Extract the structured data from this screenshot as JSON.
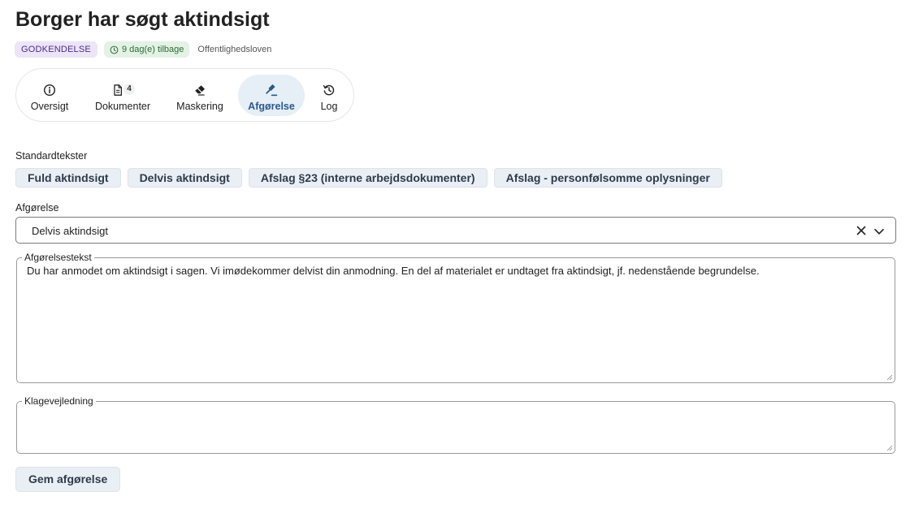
{
  "header": {
    "title": "Borger har søgt aktindsigt",
    "status_chip": "GODKENDELSE",
    "deadline_chip": "9 dag(e) tilbage",
    "law_chip": "Offentlighedsloven"
  },
  "tabs": [
    {
      "label": "Oversigt",
      "icon": "info-icon"
    },
    {
      "label": "Dokumenter",
      "icon": "document-icon",
      "badge": "4"
    },
    {
      "label": "Maskering",
      "icon": "eraser-icon"
    },
    {
      "label": "Afgørelse",
      "icon": "gavel-icon",
      "active": true
    },
    {
      "label": "Log",
      "icon": "history-icon"
    }
  ],
  "standard_texts": {
    "label": "Standardtekster",
    "buttons": [
      "Fuld aktindsigt",
      "Delvis aktindsigt",
      "Afslag §23 (interne arbejdsdokumenter)",
      "Afslag - personfølsomme oplysninger"
    ]
  },
  "decision": {
    "label": "Afgørelse",
    "value": "Delvis aktindsigt"
  },
  "decision_text": {
    "label": "Afgørelsestekst",
    "value": "Du har anmodet om aktindsigt i sagen. Vi imødekommer delvist din anmodning. En del af materialet er undtaget fra aktindsigt, jf. nedenstående begrundelse."
  },
  "appeal_guidance": {
    "label": "Klagevejledning",
    "value": ""
  },
  "actions": {
    "save_label": "Gem afgørelse"
  },
  "colors": {
    "status_chip_bg": "#ece4f7",
    "deadline_chip_bg": "#e4f2e6",
    "active_tab_bg": "#e6eef6",
    "active_tab_text": "#2b5a8a",
    "button_bg": "#e9eff5"
  }
}
